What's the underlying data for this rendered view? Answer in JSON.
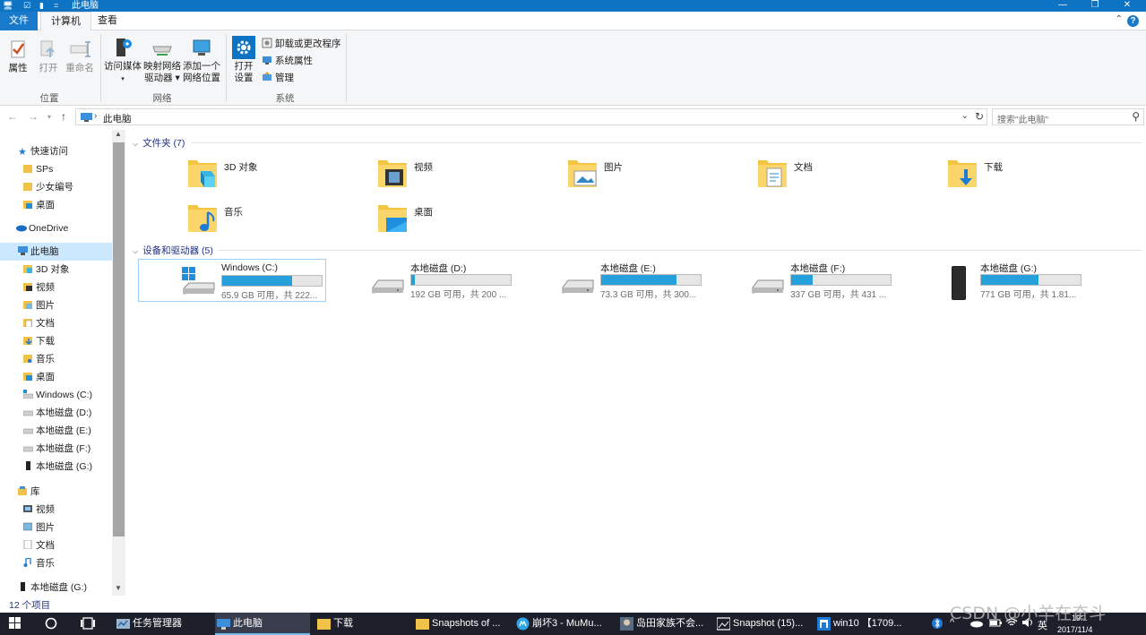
{
  "window": {
    "title": "此电脑",
    "controls": [
      "—",
      "❐",
      "✕"
    ]
  },
  "ribbon": {
    "tabs": [
      "文件",
      "计算机",
      "查看"
    ],
    "groups": {
      "location": {
        "label": "位置",
        "properties": "属性",
        "open": "打开",
        "rename": "重命名"
      },
      "network": {
        "label": "网络",
        "access_media": "访问媒体",
        "map_drive_1": "映射网络",
        "map_drive_2": "驱动器",
        "add_location_1": "添加一个",
        "add_location_2": "网络位置"
      },
      "system": {
        "label": "系统",
        "open_settings_1": "打开",
        "open_settings_2": "设置",
        "uninstall": "卸载或更改程序",
        "system_properties": "系统属性",
        "manage": "管理"
      }
    }
  },
  "address": {
    "crumb": "此电脑",
    "search_placeholder": "搜索\"此电脑\""
  },
  "nav": {
    "quick_access": "快速访问",
    "qa_items": [
      "SPs",
      "少女编号",
      "桌面"
    ],
    "onedrive": "OneDrive",
    "this_pc": "此电脑",
    "pc_items": [
      "3D 对象",
      "视频",
      "图片",
      "文档",
      "下载",
      "音乐",
      "桌面",
      "Windows (C:)",
      "本地磁盘 (D:)",
      "本地磁盘 (E:)",
      "本地磁盘 (F:)",
      "本地磁盘 (G:)"
    ],
    "libraries": "库",
    "lib_items": [
      "视频",
      "图片",
      "文档",
      "音乐"
    ],
    "bottom_item": "本地磁盘 (G:)"
  },
  "content": {
    "folders_header": "文件夹 (7)",
    "folders": [
      "3D 对象",
      "视频",
      "图片",
      "文档",
      "下载",
      "音乐",
      "桌面"
    ],
    "devices_header": "设备和驱动器 (5)",
    "drives": [
      {
        "name": "Windows (C:)",
        "info": "65.9 GB 可用，共 222...",
        "used_fraction": 0.7
      },
      {
        "name": "本地磁盘 (D:)",
        "info": "192 GB 可用，共 200 ...",
        "used_fraction": 0.04
      },
      {
        "name": "本地磁盘 (E:)",
        "info": "73.3 GB 可用，共 300...",
        "used_fraction": 0.76
      },
      {
        "name": "本地磁盘 (F:)",
        "info": "337 GB 可用，共 431 ...",
        "used_fraction": 0.22
      },
      {
        "name": "本地磁盘 (G:)",
        "info": "771 GB 可用，共 1.81...",
        "used_fraction": 0.58
      }
    ]
  },
  "status": {
    "item_count": "12 个项目"
  },
  "taskbar": {
    "items": [
      "任务管理器",
      "此电脑",
      "下载",
      "Snapshots of ...",
      "崩坏3 - MuMu...",
      "岛田家族不会...",
      "Snapshot (15)...",
      "win10 【1709..."
    ],
    "ime": "英",
    "time": "19:..",
    "date": "2017/11/4"
  },
  "watermark": "CSDN @小羊在奋斗",
  "colors": {
    "accent": "#0f73c4",
    "bar_fill": "#26a0da",
    "selection": "#cce8ff"
  }
}
